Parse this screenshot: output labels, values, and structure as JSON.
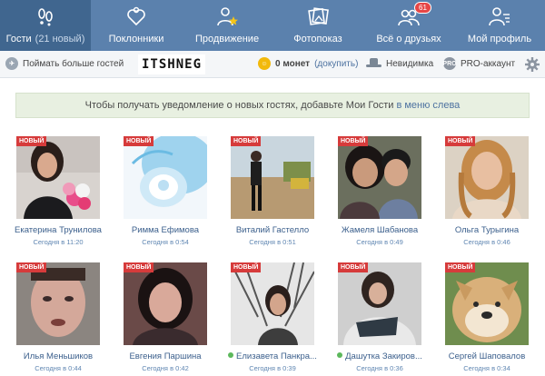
{
  "nav": {
    "items": [
      {
        "label": "Гости",
        "sub": "(21 новый)",
        "icon": "footprints-icon",
        "active": true
      },
      {
        "label": "Поклонники",
        "icon": "heart-person-icon"
      },
      {
        "label": "Продвижение",
        "icon": "person-star-icon"
      },
      {
        "label": "Фотопоказ",
        "icon": "photos-icon"
      },
      {
        "label": "Всё о друзьях",
        "icon": "friends-icon",
        "badge": "61"
      },
      {
        "label": "Мой профиль",
        "icon": "profile-list-icon"
      }
    ]
  },
  "toolbar": {
    "more_guests": "Поймать больше гостей",
    "logo": "ITSHNEG",
    "coins_amount": "0 монет",
    "coins_action": "(докупить)",
    "invisible": "Невидимка",
    "pro_badge": "PRO",
    "pro": "PRO-аккаунт"
  },
  "notice": {
    "text": "Чтобы получать уведомление о новых гостях, добавьте Мои Гости",
    "link": "в меню слева"
  },
  "new_label": "НОВЫЙ",
  "guests": [
    {
      "name": "Екатерина Трунилова",
      "time": "Сегодня в 11:20",
      "online": false,
      "photo": "woman-flowers"
    },
    {
      "name": "Римма Ефимова",
      "time": "Сегодня в 0:54",
      "online": false,
      "photo": "baby-art"
    },
    {
      "name": "Виталий Гастелло",
      "time": "Сегодня в 0:51",
      "online": false,
      "photo": "woman-outdoor"
    },
    {
      "name": "Жамеля Шабанова",
      "time": "Сегодня в 0:49",
      "online": false,
      "photo": "mother-child"
    },
    {
      "name": "Ольга Турыгина",
      "time": "Сегодня в 0:46",
      "online": false,
      "photo": "blonde-woman"
    },
    {
      "name": "Илья Меньшиков",
      "time": "Сегодня в 0:44",
      "online": false,
      "photo": "man-closeup"
    },
    {
      "name": "Евгения Паршина",
      "time": "Сегодня в 0:42",
      "online": false,
      "photo": "woman-dark-hair"
    },
    {
      "name": "Елизавета Панкра...",
      "time": "Сегодня в 0:39",
      "online": true,
      "photo": "girl-trees"
    },
    {
      "name": "Дашутка Закиров...",
      "time": "Сегодня в 0:36",
      "online": true,
      "photo": "girl-hoodie"
    },
    {
      "name": "Сергей Шаповалов",
      "time": "Сегодня в 0:34",
      "online": false,
      "photo": "dog-meme"
    }
  ],
  "colors": {
    "nav": "#5b81ad",
    "nav_active": "#40668f",
    "badge": "#e64646",
    "new": "#d63b3b",
    "link": "#3b5f8c",
    "notice_bg": "#e8f0e1"
  }
}
